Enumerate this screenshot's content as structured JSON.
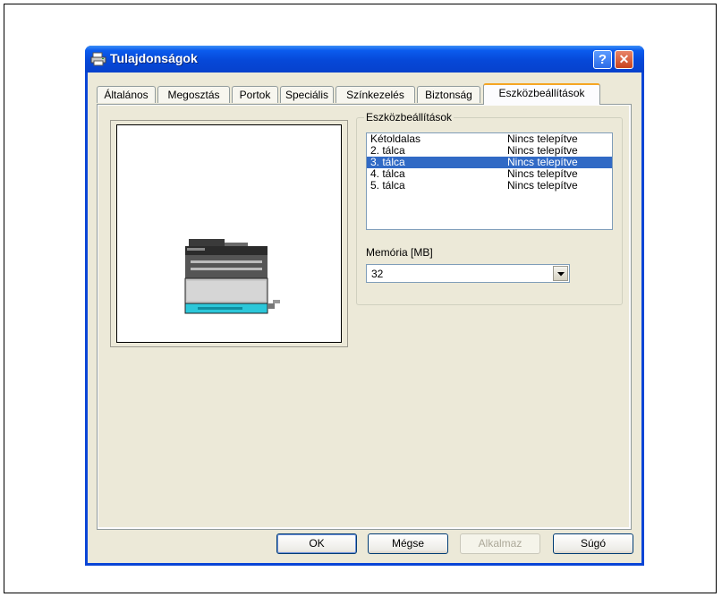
{
  "window": {
    "title": "Tulajdonságok",
    "help_label": "?",
    "close_label": "✕"
  },
  "tabs": [
    {
      "label": "Általános"
    },
    {
      "label": "Megosztás"
    },
    {
      "label": "Portok"
    },
    {
      "label": "Speciális"
    },
    {
      "label": "Színkezelés"
    },
    {
      "label": "Biztonság"
    },
    {
      "label": "Eszközbeállítások",
      "active": true
    }
  ],
  "device_settings": {
    "group_title": "Eszközbeállítások",
    "options": [
      {
        "name": "Kétoldalas",
        "status": "Nincs telepítve"
      },
      {
        "name": "2. tálca",
        "status": "Nincs telepítve"
      },
      {
        "name": "3. tálca",
        "status": "Nincs telepítve",
        "selected": true
      },
      {
        "name": "4. tálca",
        "status": "Nincs telepítve"
      },
      {
        "name": "5. tálca",
        "status": "Nincs telepítve"
      }
    ],
    "memory_label": "Memória [MB]",
    "memory_value": "32"
  },
  "buttons": {
    "ok": "OK",
    "cancel": "Mégse",
    "apply": "Alkalmaz",
    "help": "Súgó"
  },
  "icons": {
    "title": "printer-icon",
    "dropdown": "chevron-down-icon"
  }
}
